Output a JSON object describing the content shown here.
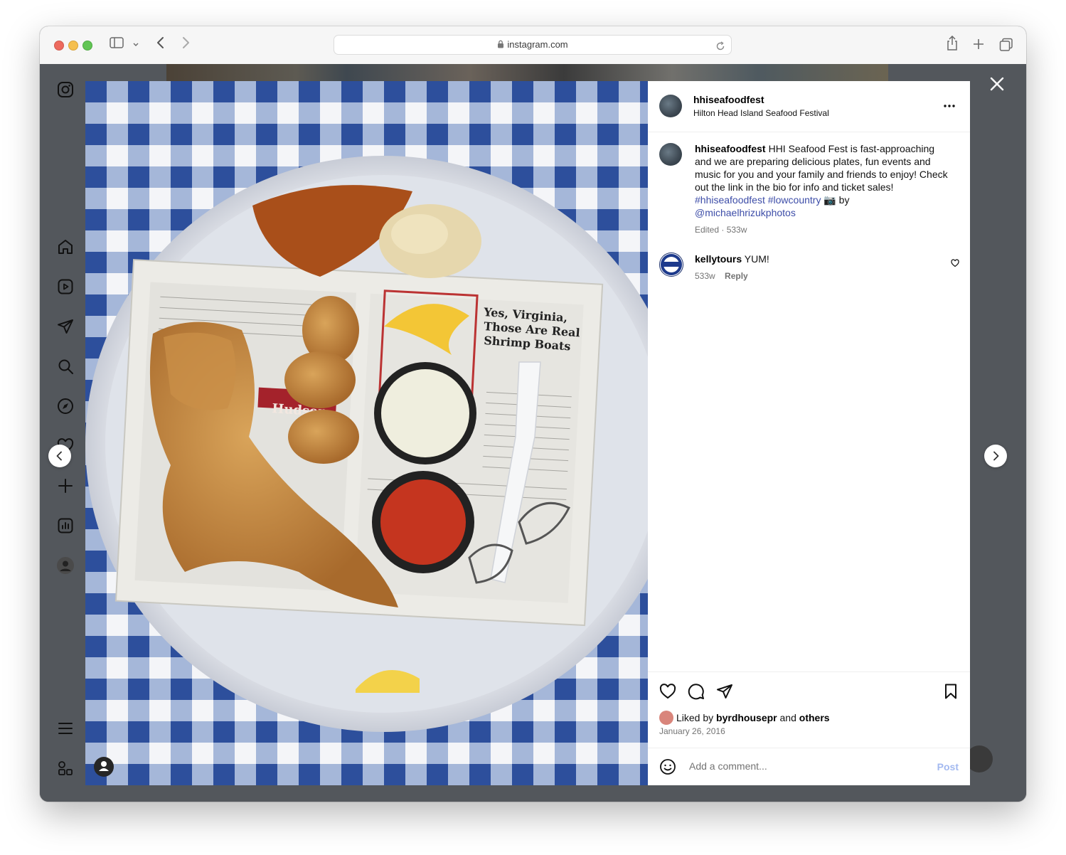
{
  "browser": {
    "url": "instagram.com"
  },
  "post": {
    "username": "hhiseafoodfest",
    "display_name": "Hilton Head Island Seafood Festival",
    "caption_user": "hhiseafoodfest",
    "caption_text": "HHI Seafood Fest is fast-approaching and we are preparing delicious plates, fun events and music for you and your family and friends to enjoy! Check out the link in the bio for info and ticket sales!",
    "hashtag_1": "#hhiseafoodfest",
    "hashtag_2": "#lowcountry",
    "camera_emoji": "📷",
    "by_text": "by",
    "mention": "@michaelhrizukphotos",
    "edited_meta": "Edited · 533w",
    "liked_by_prefix": "Liked by",
    "liked_by_user": "byrdhousepr",
    "liked_by_and": "and",
    "liked_by_others": "others",
    "date": "January 26, 2016"
  },
  "comment": {
    "username": "kellytours",
    "text": "YUM!",
    "age": "533w",
    "reply_label": "Reply"
  },
  "comment_box": {
    "placeholder": "Add a comment...",
    "post_label": "Post"
  },
  "photo_text": {
    "headline_1": "Yes, Virginia,",
    "headline_2": "Those Are Real",
    "headline_3": "Shrimp Boats",
    "side_word": "Hudson"
  },
  "colors": {
    "accent_link": "#3d4da8",
    "post_button": "#a3b9f0",
    "checker_blue": "#2d4f9c"
  }
}
